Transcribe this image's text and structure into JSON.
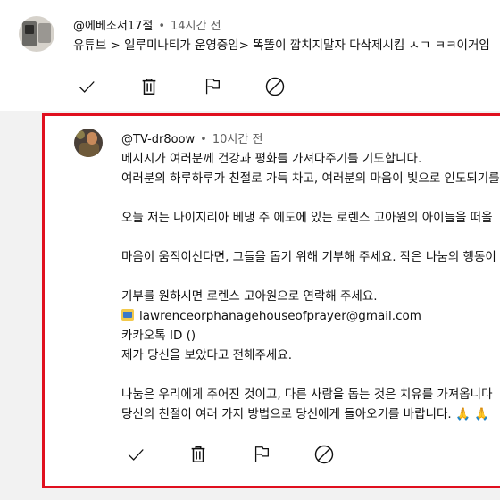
{
  "top_comment": {
    "author": "@에베소서17절",
    "time": "14시간 전",
    "text": "유튜브 > 일루미나티가 운영중임> 똑똘이 깝치지말자 다삭제시킴 ㅅㄱ ㅋㅋ이거임"
  },
  "reply": {
    "author": "@TV-dr8oow",
    "time": "10시간 전",
    "lines": {
      "l1": "메시지가 여러분께 건강과 평화를 가져다주기를 기도합니다.",
      "l2": "여러분의 하루하루가 친절로 가득 차고, 여러분의 마음이 빛으로 인도되기를",
      "l3": "오늘 저는 나이지리아 베냉 주 에도에 있는 로렌스 고아원의 아이들을 떠올",
      "l4": "마음이 움직이신다면, 그들을 돕기 위해 기부해 주세요. 작은 나눔의 행동이",
      "l5": "기부를 원하시면 로렌스 고아원으로 연락해 주세요.",
      "email": "lawrenceorphanagehouseofprayer@gmail.com",
      "l7": "카카오톡 ID ()",
      "l8": "제가 당신을 보았다고 전해주세요.",
      "l9": "나눔은 우리에게 주어진 것이고, 다른 사람을 돕는 것은 치유를 가져옵니다",
      "l10": "당신의 친절이 여러 가지 방법으로 당신에게 돌아오기를 바랍니다. 🙏 🙏"
    }
  },
  "icons": {
    "approve": "checkmark-icon",
    "remove": "trash-icon",
    "report": "flag-icon",
    "ban": "block-icon",
    "email": "envelope-icon"
  },
  "colors": {
    "highlight_border": "#e00f1e",
    "band_bg": "#f2f2f2",
    "secondary_text": "#606060",
    "icon": "#0f0f0f"
  }
}
